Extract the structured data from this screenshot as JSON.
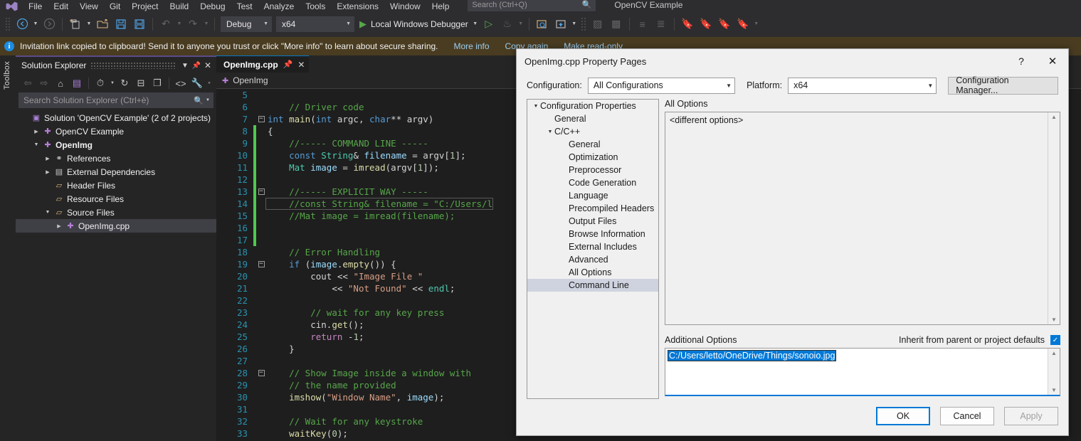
{
  "menubar": {
    "logo": "VS",
    "items": [
      "File",
      "Edit",
      "View",
      "Git",
      "Project",
      "Build",
      "Debug",
      "Test",
      "Analyze",
      "Tools",
      "Extensions",
      "Window",
      "Help"
    ],
    "search_placeholder": "Search (Ctrl+Q)",
    "window_title": "OpenCV Example"
  },
  "toolbar": {
    "config": "Debug",
    "platform": "x64",
    "run_label": "Local Windows Debugger"
  },
  "notification": {
    "message": "Invitation link copied to clipboard! Send it to anyone you trust or click \"More info\" to learn about secure sharing.",
    "links": [
      "More info",
      "Copy again",
      "Make read-only"
    ]
  },
  "toolbox": {
    "label": "Toolbox"
  },
  "solution_explorer": {
    "title": "Solution Explorer",
    "search_placeholder": "Search Solution Explorer (Ctrl+è)",
    "tree": [
      {
        "label": "Solution 'OpenCV Example' (2 of 2 projects)",
        "indent": 0,
        "arrow": "",
        "icon": "solution-icon",
        "glyph": "▣",
        "icon_class": "ico-sln",
        "bold": false,
        "selected": false
      },
      {
        "label": "OpenCV Example",
        "indent": 1,
        "arrow": "▶",
        "icon": "cpp-project-icon",
        "glyph": "✚",
        "icon_class": "ico-cpp",
        "bold": false,
        "selected": false
      },
      {
        "label": "OpenImg",
        "indent": 1,
        "arrow": "▼",
        "icon": "cpp-project-icon",
        "glyph": "✚",
        "icon_class": "ico-cpp",
        "bold": true,
        "selected": false
      },
      {
        "label": "References",
        "indent": 2,
        "arrow": "▶",
        "icon": "references-icon",
        "glyph": "⚭",
        "icon_class": "ico-ref",
        "bold": false,
        "selected": false
      },
      {
        "label": "External Dependencies",
        "indent": 2,
        "arrow": "▶",
        "icon": "dependencies-icon",
        "glyph": "▤",
        "icon_class": "ico-dep",
        "bold": false,
        "selected": false
      },
      {
        "label": "Header Files",
        "indent": 2,
        "arrow": "",
        "icon": "folder-filter-icon",
        "glyph": "▱",
        "icon_class": "ico-fold",
        "bold": false,
        "selected": false
      },
      {
        "label": "Resource Files",
        "indent": 2,
        "arrow": "",
        "icon": "folder-filter-icon",
        "glyph": "▱",
        "icon_class": "ico-fold",
        "bold": false,
        "selected": false
      },
      {
        "label": "Source Files",
        "indent": 2,
        "arrow": "▼",
        "icon": "folder-filter-icon",
        "glyph": "▱",
        "icon_class": "ico-fold",
        "bold": false,
        "selected": false
      },
      {
        "label": "OpenImg.cpp",
        "indent": 3,
        "arrow": "▶",
        "icon": "cpp-file-icon",
        "glyph": "✚",
        "icon_class": "ico-cpp",
        "bold": false,
        "selected": true
      }
    ]
  },
  "editor": {
    "tab_label": "OpenImg.cpp",
    "breadcrumb": "OpenImg",
    "lines": [
      {
        "n": "5",
        "modified": false,
        "fold": "",
        "html": ""
      },
      {
        "n": "6",
        "modified": false,
        "fold": "",
        "html": "    <span class='cm'>// Driver code</span>"
      },
      {
        "n": "7",
        "modified": false,
        "fold": "-",
        "html": "<span class='kw'>int</span> <span class='fn'>main</span><span class='pl'>(</span><span class='kw'>int</span> <span class='pl'>argc, </span><span class='kw'>char</span><span class='pl'>** argv)</span>"
      },
      {
        "n": "8",
        "modified": true,
        "fold": "",
        "html": "<span class='pl'>{</span>"
      },
      {
        "n": "9",
        "modified": true,
        "fold": "",
        "html": "    <span class='cm'>//----- COMMAND LINE -----</span>"
      },
      {
        "n": "10",
        "modified": true,
        "fold": "",
        "html": "    <span class='kw'>const</span> <span class='ty'>String</span><span class='pl'>&amp; </span><span class='va'>filename</span><span class='pl'> = argv[</span><span class='nm'>1</span><span class='pl'>];</span>"
      },
      {
        "n": "11",
        "modified": true,
        "fold": "",
        "html": "    <span class='ty'>Mat</span> <span class='va'>image</span><span class='pl'> = </span><span class='fn'>imread</span><span class='pl'>(argv[</span><span class='nm'>1</span><span class='pl'>]);</span>"
      },
      {
        "n": "12",
        "modified": true,
        "fold": "",
        "html": ""
      },
      {
        "n": "13",
        "modified": true,
        "fold": "-",
        "html": "    <span class='cm'>//----- EXPLICIT WAY -----</span>"
      },
      {
        "n": "14",
        "modified": true,
        "fold": "",
        "current": true,
        "html": "    <span class='cm'>//const String&amp; filename = \"C:/Users/l</span>"
      },
      {
        "n": "15",
        "modified": true,
        "fold": "",
        "html": "    <span class='cm'>//Mat image = imread(filename);</span>"
      },
      {
        "n": "16",
        "modified": true,
        "fold": "",
        "html": ""
      },
      {
        "n": "17",
        "modified": true,
        "fold": "",
        "html": ""
      },
      {
        "n": "18",
        "modified": false,
        "fold": "",
        "html": "    <span class='cm'>// Error Handling</span>"
      },
      {
        "n": "19",
        "modified": false,
        "fold": "-",
        "html": "    <span class='kw'>if</span> <span class='pl'>(</span><span class='va'>image</span><span class='pl'>.</span><span class='fn'>empty</span><span class='pl'>()) {</span>"
      },
      {
        "n": "20",
        "modified": false,
        "fold": "",
        "html": "        <span class='pl'>cout &lt;&lt; </span><span class='st'>\"Image File \"</span>"
      },
      {
        "n": "21",
        "modified": false,
        "fold": "",
        "html": "            <span class='pl'>&lt;&lt; </span><span class='st'>\"Not Found\"</span><span class='pl'> &lt;&lt; </span><span class='ty'>endl</span><span class='pl'>;</span>"
      },
      {
        "n": "22",
        "modified": false,
        "fold": "",
        "html": ""
      },
      {
        "n": "23",
        "modified": false,
        "fold": "",
        "html": "        <span class='cm'>// wait for any key press</span>"
      },
      {
        "n": "24",
        "modified": false,
        "fold": "",
        "html": "        <span class='pl'>cin.</span><span class='fn'>get</span><span class='pl'>();</span>"
      },
      {
        "n": "25",
        "modified": false,
        "fold": "",
        "html": "        <span class='kwp'>return</span> <span class='pl'>-</span><span class='nm'>1</span><span class='pl'>;</span>"
      },
      {
        "n": "26",
        "modified": false,
        "fold": "",
        "html": "    <span class='pl'>}</span>"
      },
      {
        "n": "27",
        "modified": false,
        "fold": "",
        "html": ""
      },
      {
        "n": "28",
        "modified": false,
        "fold": "-",
        "html": "    <span class='cm'>// Show Image inside a window with</span>"
      },
      {
        "n": "29",
        "modified": false,
        "fold": "",
        "html": "    <span class='cm'>// the name provided</span>"
      },
      {
        "n": "30",
        "modified": false,
        "fold": "",
        "html": "    <span class='fn'>imshow</span><span class='pl'>(</span><span class='st'>\"Window Name\"</span><span class='pl'>, </span><span class='va'>image</span><span class='pl'>);</span>"
      },
      {
        "n": "31",
        "modified": false,
        "fold": "",
        "html": ""
      },
      {
        "n": "32",
        "modified": false,
        "fold": "",
        "html": "    <span class='cm'>// Wait for any keystroke</span>"
      },
      {
        "n": "33",
        "modified": false,
        "fold": "",
        "html": "    <span class='fn'>waitKey</span><span class='pl'>(</span><span class='nm'>0</span><span class='pl'>);</span>"
      }
    ]
  },
  "dialog": {
    "title": "OpenImg.cpp Property Pages",
    "help_glyph": "?",
    "close_glyph": "✕",
    "configuration_label": "Configuration:",
    "configuration_value": "All Configurations",
    "platform_label": "Platform:",
    "platform_value": "x64",
    "config_manager_label": "Configuration Manager...",
    "tree": [
      {
        "label": "Configuration Properties",
        "indent": 0,
        "arrow": "▼",
        "selected": false
      },
      {
        "label": "General",
        "indent": 1,
        "arrow": "",
        "selected": false
      },
      {
        "label": "C/C++",
        "indent": 1,
        "arrow": "▼",
        "selected": false
      },
      {
        "label": "General",
        "indent": 2,
        "arrow": "",
        "selected": false
      },
      {
        "label": "Optimization",
        "indent": 2,
        "arrow": "",
        "selected": false
      },
      {
        "label": "Preprocessor",
        "indent": 2,
        "arrow": "",
        "selected": false
      },
      {
        "label": "Code Generation",
        "indent": 2,
        "arrow": "",
        "selected": false
      },
      {
        "label": "Language",
        "indent": 2,
        "arrow": "",
        "selected": false
      },
      {
        "label": "Precompiled Headers",
        "indent": 2,
        "arrow": "",
        "selected": false
      },
      {
        "label": "Output Files",
        "indent": 2,
        "arrow": "",
        "selected": false
      },
      {
        "label": "Browse Information",
        "indent": 2,
        "arrow": "",
        "selected": false
      },
      {
        "label": "External Includes",
        "indent": 2,
        "arrow": "",
        "selected": false
      },
      {
        "label": "Advanced",
        "indent": 2,
        "arrow": "",
        "selected": false
      },
      {
        "label": "All Options",
        "indent": 2,
        "arrow": "",
        "selected": false
      },
      {
        "label": "Command Line",
        "indent": 2,
        "arrow": "",
        "selected": true
      }
    ],
    "all_options_label": "All Options",
    "all_options_value": "<different options>",
    "additional_options_label": "Additional Options",
    "inherit_label": "Inherit from parent or project defaults",
    "inherit_checked": true,
    "additional_options_value": "C:/Users/letto/OneDrive/Things/sonoio.jpg",
    "buttons": {
      "ok": "OK",
      "cancel": "Cancel",
      "apply": "Apply"
    }
  },
  "colors": {
    "accent": "#0078d7",
    "vs_chrome": "#2d2d30",
    "editor_bg": "#1e1e1e",
    "notify_bg": "#493c21",
    "comment_green": "#57a64a",
    "linenum_blue": "#2b91af"
  }
}
